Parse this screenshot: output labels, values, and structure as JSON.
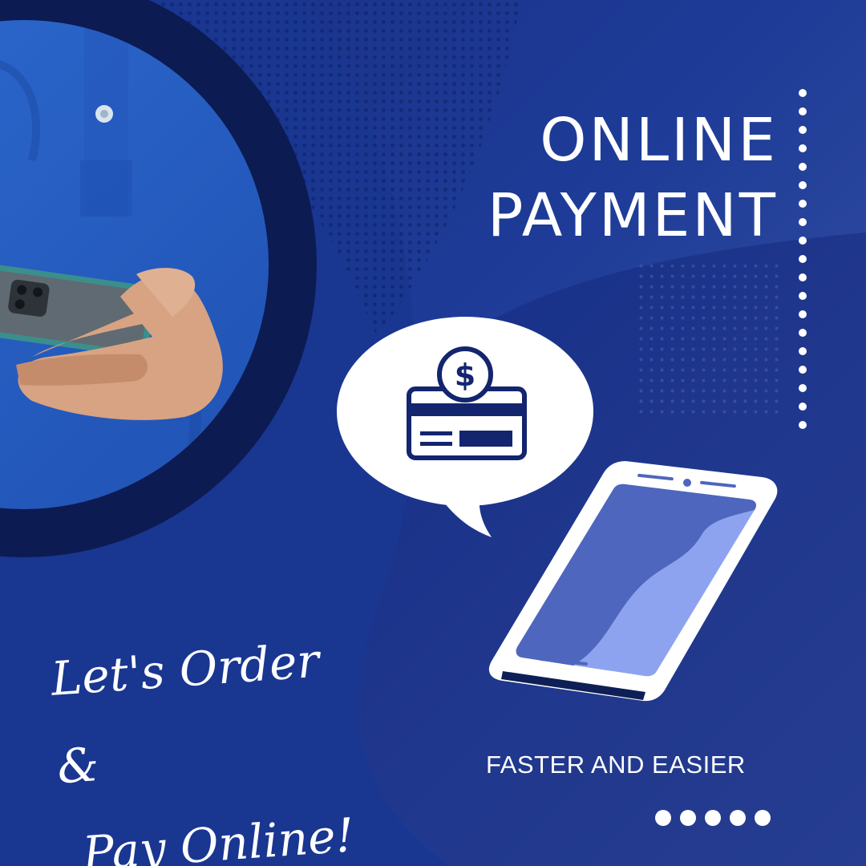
{
  "headline": {
    "line1": "ONLINE",
    "line2": "PAYMENT"
  },
  "tagline": {
    "line1": "Let's Order &",
    "line2": "Pay Online!"
  },
  "subtitle": "FASTER AND EASIER",
  "icons": {
    "coin_symbol": "$",
    "card": "credit-card-icon",
    "phone": "smartphone-icon",
    "bubble": "speech-bubble"
  },
  "colors": {
    "background": "#1d3b97",
    "navy": "#0d1f55",
    "shirt_blue": "#2d62c7",
    "white": "#ffffff",
    "screen_light": "#8ea3ef",
    "screen_dark": "#4e66bd"
  }
}
